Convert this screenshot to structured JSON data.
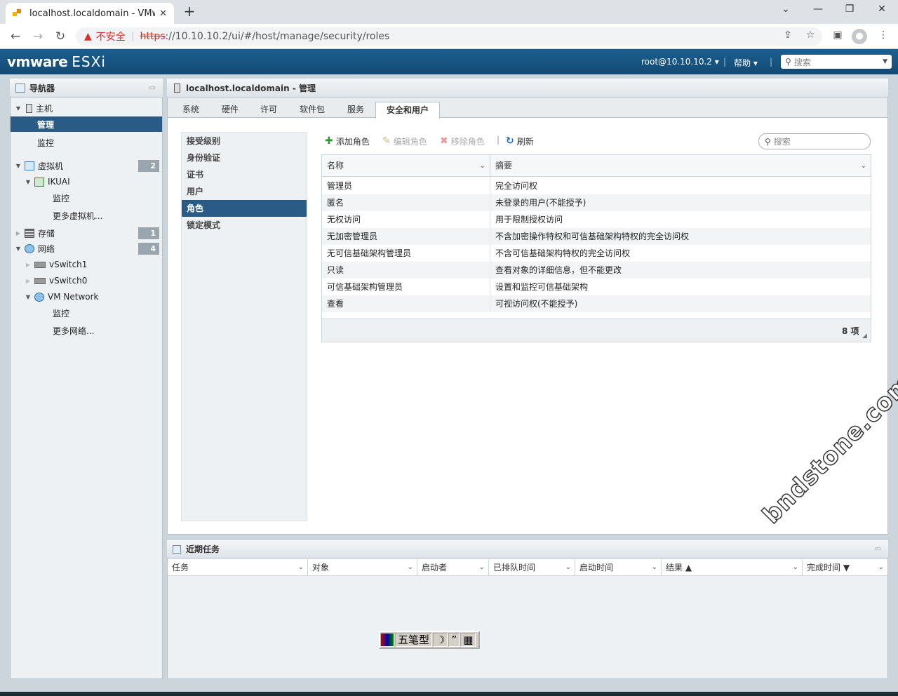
{
  "browser": {
    "tab_title": "localhost.localdomain - VMwa",
    "url_warning": "不安全",
    "url_scheme": "https",
    "url_rest": "://10.10.10.2/ui/#/host/manage/security/roles"
  },
  "header": {
    "brand": "vmware",
    "product": "ESXi",
    "user": "root@10.10.10.2 ▾",
    "help": "帮助 ▾",
    "search_placeholder": "搜索"
  },
  "navigator": {
    "title": "导航器",
    "items": [
      {
        "label": "主机"
      },
      {
        "label": "管理"
      },
      {
        "label": "监控"
      },
      {
        "label": "虚拟机",
        "badge": "2"
      },
      {
        "label": "IKUAI"
      },
      {
        "label": "监控"
      },
      {
        "label": "更多虚拟机..."
      },
      {
        "label": "存储",
        "badge": "1"
      },
      {
        "label": "网络",
        "badge": "4"
      },
      {
        "label": "vSwitch1"
      },
      {
        "label": "vSwitch0"
      },
      {
        "label": "VM Network"
      },
      {
        "label": "监控"
      },
      {
        "label": "更多网络..."
      }
    ]
  },
  "main": {
    "title": "localhost.localdomain - 管理",
    "tabs": [
      "系统",
      "硬件",
      "许可",
      "软件包",
      "服务",
      "安全和用户"
    ],
    "subnav": [
      "接受级别",
      "身份验证",
      "证书",
      "用户",
      "角色",
      "锁定模式"
    ],
    "toolbar": {
      "add": "添加角色",
      "edit": "编辑角色",
      "remove": "移除角色",
      "refresh": "刷新",
      "search_placeholder": "搜索"
    },
    "grid": {
      "columns": [
        "名称",
        "摘要"
      ],
      "rows": [
        {
          "name": "管理员",
          "summary": "完全访问权"
        },
        {
          "name": "匿名",
          "summary": "未登录的用户(不能授予)"
        },
        {
          "name": "无权访问",
          "summary": "用于限制授权访问"
        },
        {
          "name": "无加密管理员",
          "summary": "不含加密操作特权和可信基础架构特权的完全访问权"
        },
        {
          "name": "无可信基础架构管理员",
          "summary": "不含可信基础架构特权的完全访问权"
        },
        {
          "name": "只读",
          "summary": "查看对象的详细信息，但不能更改"
        },
        {
          "name": "可信基础架构管理员",
          "summary": "设置和监控可信基础架构"
        },
        {
          "name": "查看",
          "summary": "可视访问权(不能授予)"
        }
      ],
      "count": "8 项"
    },
    "watermark": "bndstone.com"
  },
  "tasks": {
    "title": "近期任务",
    "columns": [
      "任务",
      "对象",
      "启动者",
      "已排队时间",
      "启动时间",
      "结果 ▲",
      "完成时间 ▼"
    ]
  },
  "ime": {
    "label": "五笔型"
  }
}
